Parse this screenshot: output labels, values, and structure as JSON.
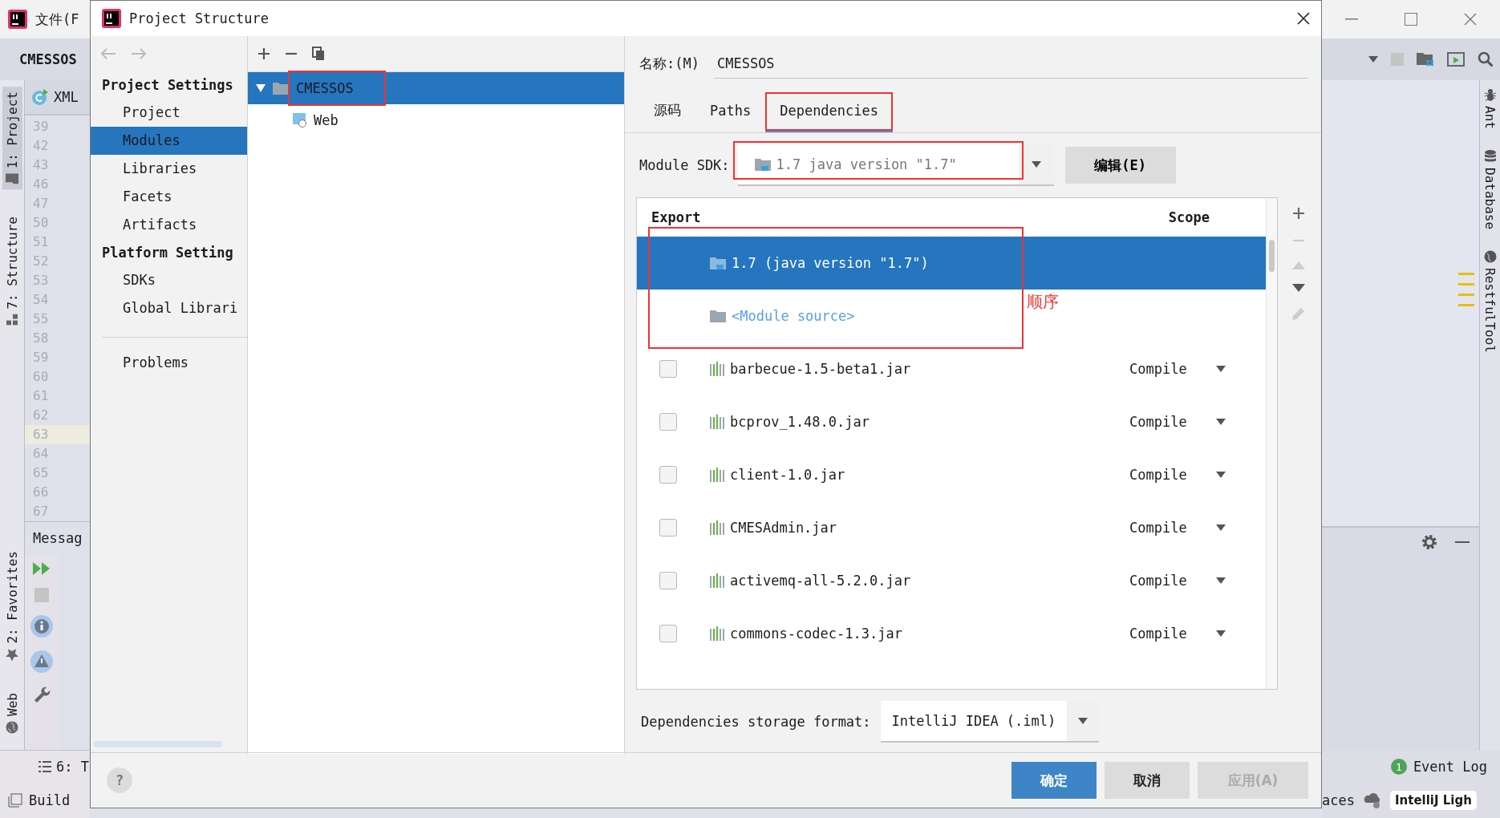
{
  "ide": {
    "menu_text": "文件(F",
    "project_tab": "CMESSOS",
    "editor_tab": "XML",
    "left_tool_tabs": [
      {
        "label": "1: Project",
        "selected": true
      },
      {
        "label": "7: Structure",
        "selected": false
      }
    ],
    "left_bottom_tool_tabs": [
      {
        "label": "2: Favorites",
        "selected": false
      },
      {
        "label": "Web",
        "selected": false
      }
    ],
    "line_numbers": [
      {
        "number": "39",
        "current": false
      },
      {
        "number": "42",
        "current": false
      },
      {
        "number": "43",
        "current": false
      },
      {
        "number": "46",
        "current": false
      },
      {
        "number": "47",
        "current": false
      },
      {
        "number": "50",
        "current": false
      },
      {
        "number": "51",
        "current": false
      },
      {
        "number": "52",
        "current": false
      },
      {
        "number": "53",
        "current": false
      },
      {
        "number": "54",
        "current": false
      },
      {
        "number": "55",
        "current": false
      },
      {
        "number": "58",
        "current": false
      },
      {
        "number": "59",
        "current": false
      },
      {
        "number": "60",
        "current": false
      },
      {
        "number": "61",
        "current": false
      },
      {
        "number": "62",
        "current": false
      },
      {
        "number": "63",
        "current": true
      },
      {
        "number": "64",
        "current": false
      },
      {
        "number": "65",
        "current": false
      },
      {
        "number": "66",
        "current": false
      },
      {
        "number": "67",
        "current": false
      }
    ],
    "messages_title": "Messag",
    "bottom_tabs": [
      {
        "label": "6: T"
      },
      {
        "label": "Build"
      }
    ],
    "right_tool_tabs": [
      {
        "label": "Ant"
      },
      {
        "label": "Database"
      },
      {
        "label": "RestfulTool"
      }
    ],
    "event_log": {
      "count": "1",
      "label": "Event Log"
    },
    "status_text": "aces",
    "theme_label": "IntelliJ Ligh"
  },
  "dialog": {
    "title": "Project Structure",
    "nav": {
      "sections": [
        {
          "title": "Project Settings",
          "items": [
            {
              "label": "Project",
              "selected": false
            },
            {
              "label": "Modules",
              "selected": true
            },
            {
              "label": "Libraries",
              "selected": false
            },
            {
              "label": "Facets",
              "selected": false
            },
            {
              "label": "Artifacts",
              "selected": false
            }
          ]
        },
        {
          "title": "Platform Setting",
          "items": [
            {
              "label": "SDKs",
              "selected": false
            },
            {
              "label": "Global Librari",
              "selected": false
            }
          ]
        }
      ],
      "extra_items": [
        {
          "label": "Problems",
          "selected": false
        }
      ]
    },
    "module_tree": [
      {
        "label": "CMESSOS",
        "selected": true,
        "expanded": true,
        "annotated": true,
        "children": [
          {
            "label": "Web",
            "selected": false,
            "annotated": false
          }
        ]
      }
    ],
    "name_field": {
      "label": "名称:(M)",
      "value": "CMESSOS"
    },
    "tabs": [
      {
        "label": "源码",
        "selected": false,
        "annotated": false
      },
      {
        "label": "Paths",
        "selected": false,
        "annotated": false
      },
      {
        "label": "Dependencies",
        "selected": true,
        "annotated": true
      }
    ],
    "module_sdk": {
      "label": "Module SDK:",
      "value": "1.7 java version \"1.7\"",
      "annotated": true,
      "edit_button": "编辑(E)"
    },
    "dependencies": {
      "columns": [
        "Export",
        "Scope"
      ],
      "rows": [
        {
          "kind": "sdk",
          "name": "1.7 (java version \"1.7\")",
          "selected": true,
          "annotated": true
        },
        {
          "kind": "module_source",
          "name": "<Module source>",
          "selected": false,
          "annotated": true
        },
        {
          "kind": "library",
          "name": "barbecue-1.5-beta1.jar",
          "exported": false,
          "scope": "Compile",
          "selected": false,
          "annotated": false
        },
        {
          "kind": "library",
          "name": "bcprov_1.48.0.jar",
          "exported": false,
          "scope": "Compile",
          "selected": false,
          "annotated": false
        },
        {
          "kind": "library",
          "name": "client-1.0.jar",
          "exported": false,
          "scope": "Compile",
          "selected": false,
          "annotated": false
        },
        {
          "kind": "library",
          "name": "CMESAdmin.jar",
          "exported": false,
          "scope": "Compile",
          "selected": false,
          "annotated": false
        },
        {
          "kind": "library",
          "name": "activemq-all-5.2.0.jar",
          "exported": false,
          "scope": "Compile",
          "selected": false,
          "annotated": false
        },
        {
          "kind": "library",
          "name": "commons-codec-1.3.jar",
          "exported": false,
          "scope": "Compile",
          "selected": false,
          "annotated": false
        }
      ],
      "annotation_note": "顺序"
    },
    "storage_format": {
      "label": "Dependencies storage format:",
      "value": "IntelliJ IDEA (.iml)"
    },
    "help_button": "?",
    "buttons": [
      {
        "label": "确定",
        "primary": true,
        "disabled": false
      },
      {
        "label": "取消",
        "primary": false,
        "disabled": false
      },
      {
        "label": "应用(A)",
        "primary": false,
        "disabled": true
      }
    ]
  }
}
